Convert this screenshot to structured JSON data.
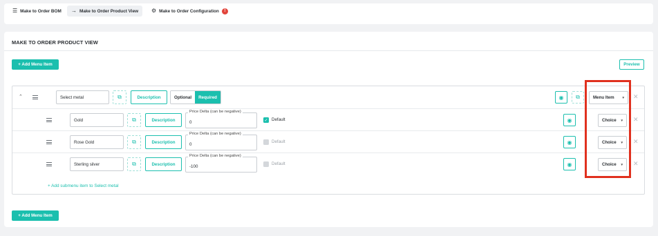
{
  "tabs": [
    {
      "label": "Make to Order BOM",
      "icon": "list-icon"
    },
    {
      "label": "Make to Order Product View",
      "icon": "arrow-right-icon"
    },
    {
      "label": "Make to Order Configuration",
      "icon": "gear-icon",
      "badge": "!"
    }
  ],
  "title": "MAKE TO ORDER PRODUCT VIEW",
  "add_menu_item_label": "+ Add Menu Item",
  "preview_label": "Preview",
  "menu": {
    "name": "Select metal",
    "description_label": "Description",
    "optional_label": "Optional",
    "required_label": "Required",
    "selected_requirement": "Required",
    "type": "Menu Item"
  },
  "items": [
    {
      "name": "Gold",
      "description_label": "Description",
      "price_label": "Price Delta (can be negative)",
      "price": "0",
      "default_label": "Default",
      "default_checked": true,
      "type": "Choice"
    },
    {
      "name": "Rose Gold",
      "description_label": "Description",
      "price_label": "Price Delta (can be negative)",
      "price": "0",
      "default_label": "Default",
      "default_checked": false,
      "type": "Choice"
    },
    {
      "name": "Sterling silver",
      "description_label": "Description",
      "price_label": "Price Delta (can be negative)",
      "price": "-100",
      "default_label": "Default",
      "default_checked": false,
      "type": "Choice"
    }
  ],
  "add_submenu_label": "+ Add submenu item to Select metal",
  "colors": {
    "accent": "#1bbfae",
    "highlight": "#e0301e",
    "warning": "#e2453c"
  }
}
